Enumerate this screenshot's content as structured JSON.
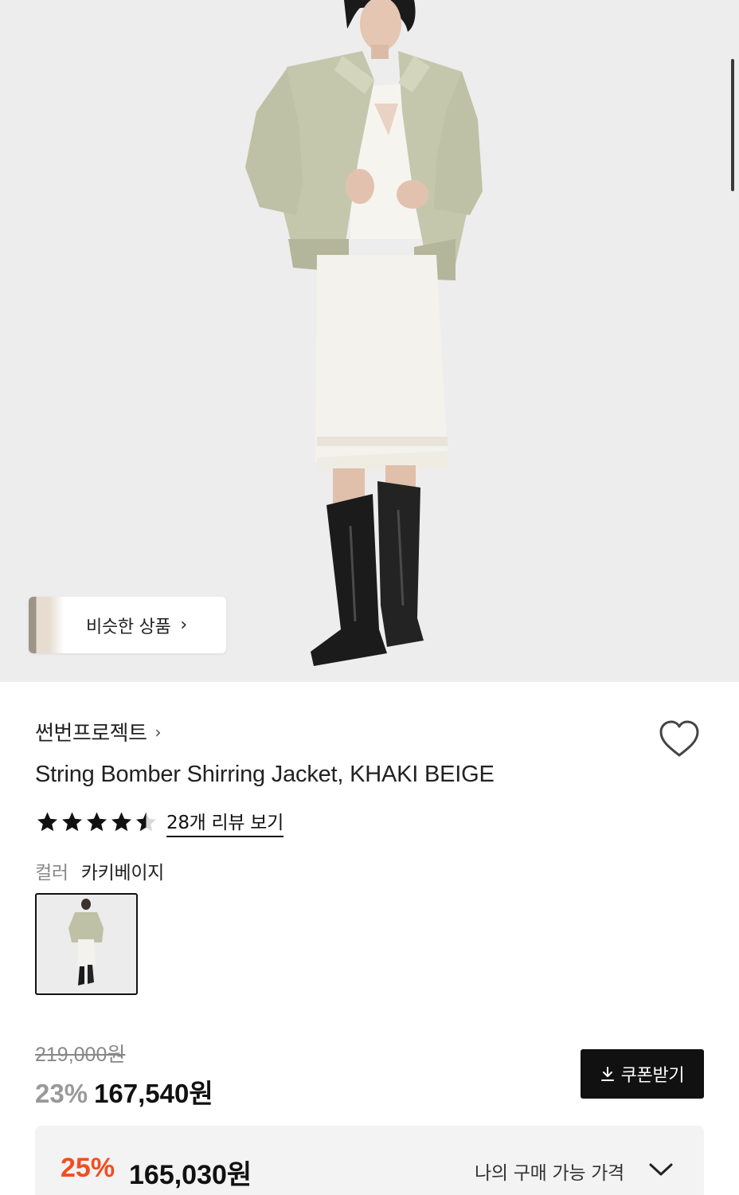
{
  "hero": {
    "similar_products_label": "비슷한 상품"
  },
  "product": {
    "brand": "썬번프로젝트",
    "title": "String Bomber Shirring Jacket, KHAKI BEIGE",
    "rating_stars": 4.5,
    "review_link": "28개 리뷰 보기",
    "color_label": "컬러",
    "color_value": "카키베이지"
  },
  "price": {
    "original": "219,000원",
    "discount_percent": "23%",
    "sale_price": "167,540원",
    "coupon_button": "쿠폰받기",
    "best_percent": "25%",
    "best_price": "165,030원",
    "best_label": "나의 구매 가능 가격"
  },
  "colors": {
    "accent_orange": "#f24e1e",
    "button_black": "#111111",
    "hero_background": "#ededed"
  },
  "icons": {
    "wishlist": "heart-outline-icon",
    "download": "download-icon",
    "expand": "chevron-down-icon"
  }
}
